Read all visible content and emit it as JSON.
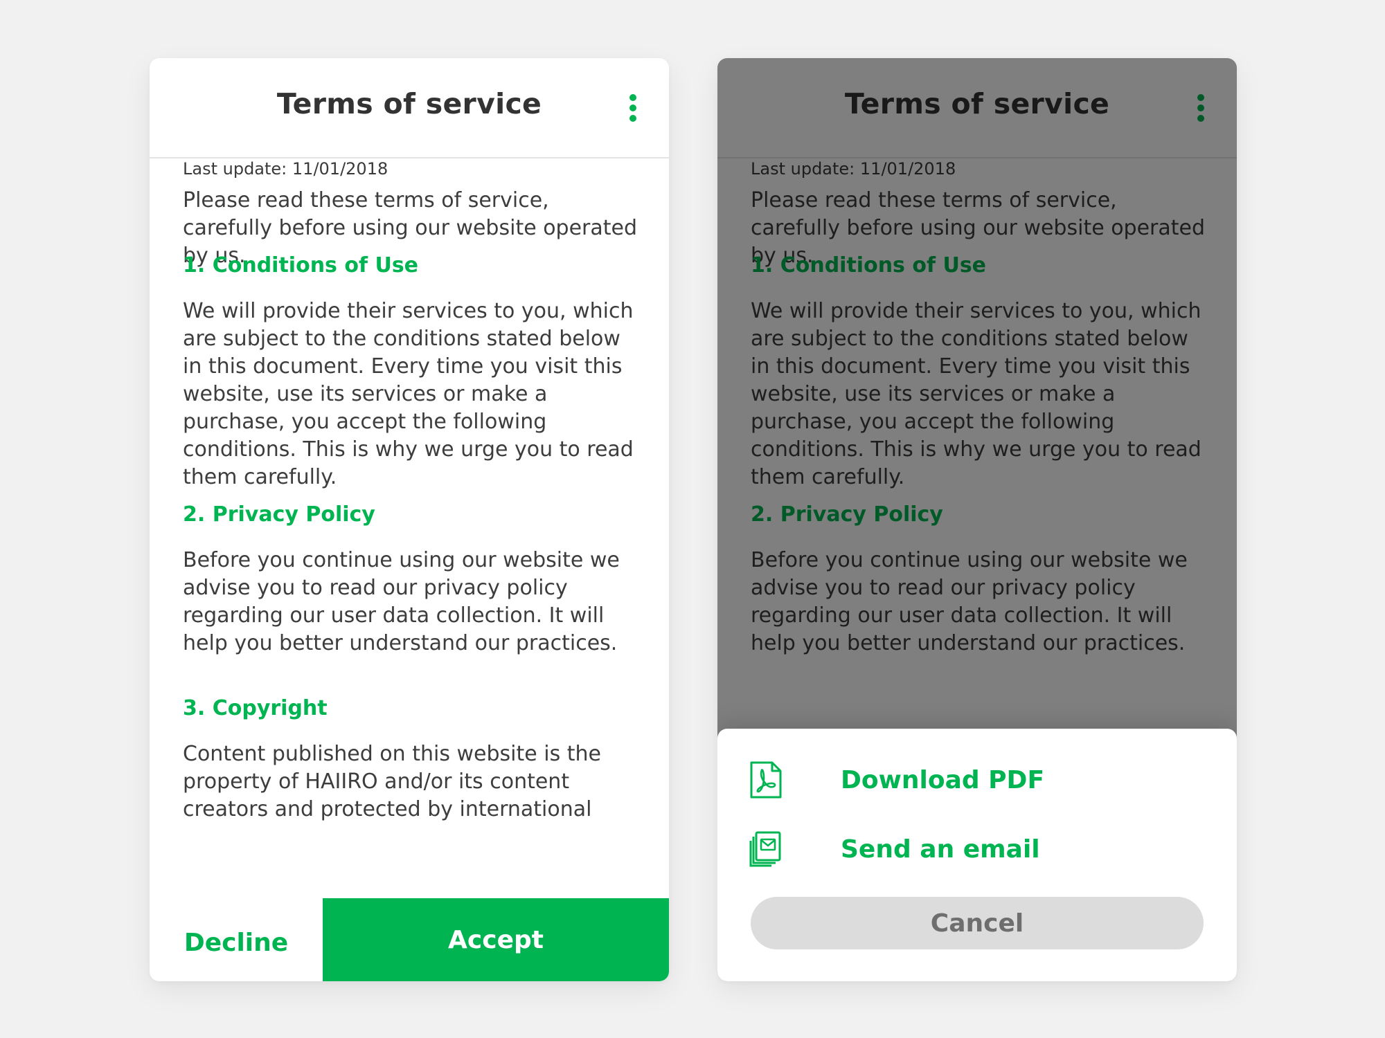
{
  "colors": {
    "accent": "#00b451",
    "background": "#f1f1f1",
    "card": "#ffffff",
    "text": "#3a3a3a",
    "cancel_bg": "#dcdcdc"
  },
  "screen_left": {
    "title": "Terms of service",
    "menu_icon": "kebab-vertical-icon",
    "last_update": "Last update: 11/01/2018",
    "intro": "Please read these terms of service, carefully before using our website operated by us.",
    "sections": [
      {
        "title": "1. Conditions of Use",
        "text": "We will provide their services to you, which are subject to the conditions stated below in this document. Every time you visit this website, use its services or make a purchase, you accept the following conditions. This is why we urge you to read them carefully."
      },
      {
        "title": "2. Privacy Policy",
        "text": "Before you continue using our website we advise you to read our privacy policy regarding our user data collection. It will help you better understand our practices."
      },
      {
        "title": "3. Copyright",
        "text": "Content published on this website is the property of HAIIRO and/or its content creators and protected by international"
      }
    ],
    "decline_label": "Decline",
    "accept_label": "Accept"
  },
  "screen_right": {
    "title": "Terms of service",
    "menu_icon": "kebab-vertical-icon",
    "last_update": "Last update: 11/01/2018",
    "intro": "Please read these terms of service, carefully before using our website operated by us.",
    "sections": [
      {
        "title": "1. Conditions of Use",
        "text": "We will provide their services to you, which are subject to the conditions stated below in this document. Every time you visit this website, use its services or make a purchase, you accept the following conditions. This is why we urge you to read them carefully."
      },
      {
        "title": "2. Privacy Policy",
        "text": "Before you continue using our website we advise you to read our privacy policy regarding our user data collection. It will help you better understand our practices."
      }
    ],
    "actions": [
      {
        "label": "Download PDF",
        "icon": "pdf-file-icon"
      },
      {
        "label": "Send an email",
        "icon": "email-icon"
      }
    ],
    "cancel_label": "Cancel"
  }
}
